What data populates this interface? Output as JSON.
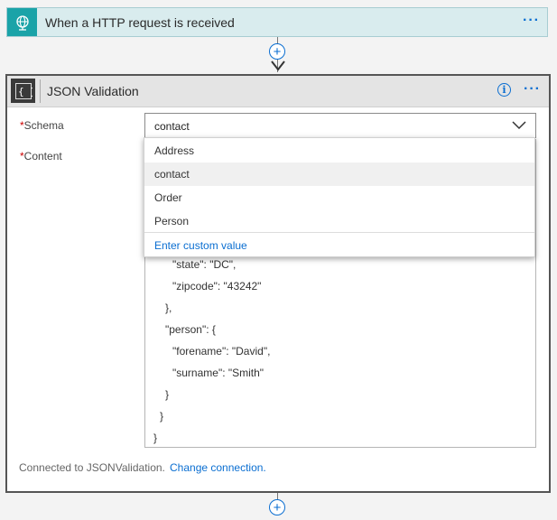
{
  "trigger": {
    "title": "When a HTTP request is received",
    "more": "···"
  },
  "action": {
    "title": "JSON Validation",
    "more": "···",
    "info": "i",
    "schema_label": "Schema",
    "content_label": "Content",
    "required_mark": "*",
    "schema_value": "contact",
    "content_lines": [
      "\"state\": \"DC\",",
      "\"zipcode\": \"43242\"",
      "},",
      "\"person\": {",
      "\"forename\": \"David\",",
      "\"surname\": \"Smith\"",
      "}",
      "}",
      "}"
    ],
    "footer_text": "Connected to JSONValidation.",
    "footer_link": "Change connection."
  },
  "dropdown": {
    "options": [
      "Address",
      "contact",
      "Order",
      "Person"
    ],
    "selected": "contact",
    "custom": "Enter custom value"
  },
  "icons": {
    "trigger": "globe-icon",
    "action": "json-braces-icon",
    "add": "plus-icon",
    "chevron": "chevron-down-icon"
  },
  "colors": {
    "accent": "#0a6ed1",
    "trigger_bg": "#d9ecee",
    "trigger_icon": "#1aa3a8",
    "required": "#cc0000"
  }
}
